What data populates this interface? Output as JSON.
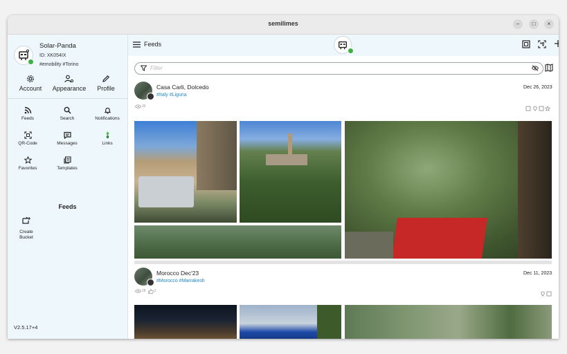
{
  "window": {
    "title": "semilimes",
    "minimize": "–",
    "maximize": "□",
    "close": "×"
  },
  "user": {
    "name": "Solar-Panda",
    "id": "ID: XK054IX",
    "tags": "#emobility #Torino"
  },
  "top_actions": [
    {
      "label": "Account",
      "icon": "gear-icon"
    },
    {
      "label": "Appearance",
      "icon": "appearance-icon"
    },
    {
      "label": "Profile",
      "icon": "pencil-icon"
    }
  ],
  "nav": [
    {
      "label": "Feeds",
      "icon": "rss-icon"
    },
    {
      "label": "Search",
      "icon": "search-icon"
    },
    {
      "label": "Notifications",
      "icon": "bell-icon"
    },
    {
      "label": "QR-Code",
      "icon": "qr-icon"
    },
    {
      "label": "Messages",
      "icon": "message-icon"
    },
    {
      "label": "Links",
      "icon": "links-icon"
    },
    {
      "label": "Favorites",
      "icon": "star-icon"
    },
    {
      "label": "Templates",
      "icon": "templates-icon"
    }
  ],
  "feeds_section": {
    "title": "Feeds",
    "create_bucket": "Create Bucket"
  },
  "version": "V2.5.17+4",
  "header": {
    "title": "Feeds"
  },
  "filter": {
    "placeholder": "Filter"
  },
  "posts": [
    {
      "title": "Casa Carli, Dolcedo",
      "tags": "#Italy #Liguria",
      "date": "Dec 26, 2023",
      "views": "36",
      "likes": ""
    },
    {
      "title": "Morocco Dec'23",
      "tags": "#Morocco #Marrakesh",
      "date": "Dec 11, 2023",
      "views": "28",
      "likes": "2"
    }
  ],
  "colors": {
    "accent": "#1e88c9",
    "online": "#3cb043",
    "sidebar_bg": "#eef7fb"
  }
}
